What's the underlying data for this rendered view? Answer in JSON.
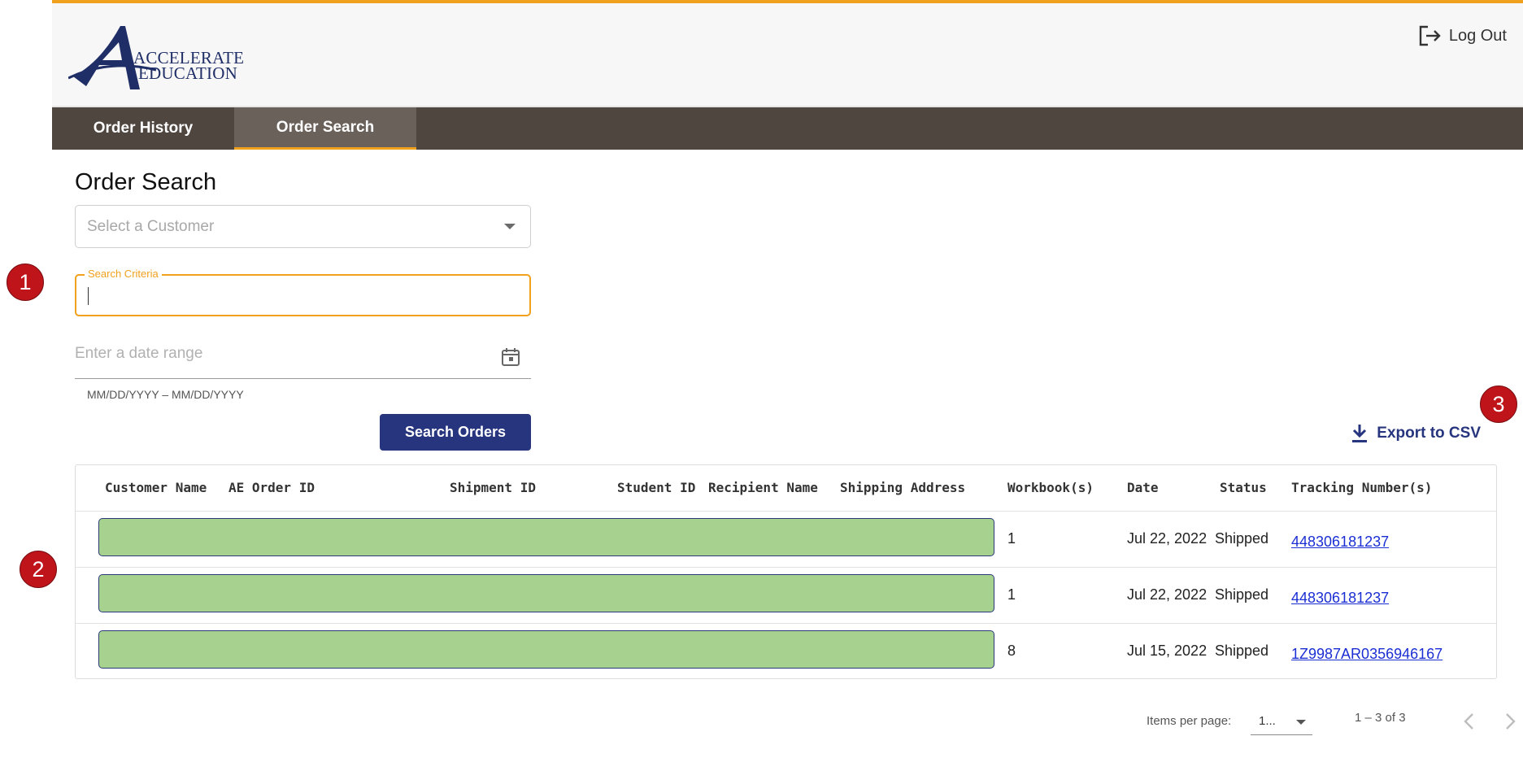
{
  "header": {
    "logo": {
      "line1": "ACCELERATE",
      "line2": "EDUCATION"
    },
    "logout_label": "Log Out"
  },
  "nav": {
    "tabs": [
      {
        "label": "Order History",
        "active": false
      },
      {
        "label": "Order Search",
        "active": true
      }
    ]
  },
  "page": {
    "title": "Order Search"
  },
  "form": {
    "customer_select": {
      "placeholder": "Select a Customer"
    },
    "search_criteria": {
      "label": "Search Criteria",
      "value": ""
    },
    "date_range": {
      "placeholder": "Enter a date range",
      "hint": "MM/DD/YYYY – MM/DD/YYYY"
    },
    "search_button": "Search Orders"
  },
  "export": {
    "label": "Export to CSV"
  },
  "table": {
    "columns": [
      "Customer Name",
      "AE Order ID",
      "Shipment ID",
      "Student ID",
      "Recipient Name",
      "Shipping Address",
      "Workbook(s)",
      "Date",
      "Status",
      "Tracking Number(s)"
    ],
    "rows": [
      {
        "workbooks": "1",
        "date": "Jul 22, 2022",
        "status": "Shipped",
        "tracking": "448306181237"
      },
      {
        "workbooks": "1",
        "date": "Jul 22, 2022",
        "status": "Shipped",
        "tracking": "448306181237"
      },
      {
        "workbooks": "8",
        "date": "Jul 15, 2022",
        "status": "Shipped",
        "tracking": "1Z9987AR0356946167"
      }
    ]
  },
  "paginator": {
    "items_per_page_label": "Items per page:",
    "items_per_page_value": "1...",
    "range_label": "1 – 3 of 3"
  },
  "callouts": [
    "1",
    "2",
    "3"
  ],
  "colors": {
    "accent": "#f0a11e",
    "nav_bg": "#4f4640",
    "primary": "#26357e",
    "redaction": "#a7d18f",
    "link": "#1a2ed4",
    "callout": "#c0141b"
  }
}
